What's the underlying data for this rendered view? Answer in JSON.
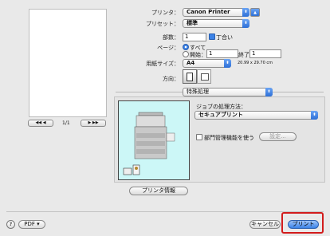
{
  "printer": {
    "label": "プリンタ：",
    "value": "Canon Printer"
  },
  "preset": {
    "label": "プリセット：",
    "value": "標準"
  },
  "copies": {
    "label": "部数：",
    "value": "1",
    "collate": "丁合い"
  },
  "pages": {
    "label": "ページ：",
    "all": "すべて",
    "from": "開始：",
    "from_value": "1",
    "to": "終了：",
    "to_value": "1"
  },
  "paper": {
    "label": "用紙サイズ：",
    "value": "A4",
    "size_text": "20.99 x 29.70 cm"
  },
  "orientation": {
    "label": "方向："
  },
  "panel_popup": {
    "value": "特殊処理"
  },
  "job": {
    "label": "ジョブの処理方法：",
    "value": "セキュアプリント"
  },
  "dept": {
    "label": "部門管理機能を使う",
    "settings": "設定..."
  },
  "printer_info": "プリンタ情報",
  "pager": {
    "prev": "◀◀  ◀",
    "text": "1/1",
    "next": "▶  ▶▶"
  },
  "help": "?",
  "pdf": "PDF ▾",
  "cancel": "キャンセル",
  "print": "プリント",
  "colors": {
    "accent": "#3b82e6",
    "highlight": "#d21c1c",
    "preview_bg": "#ccf7f7"
  }
}
